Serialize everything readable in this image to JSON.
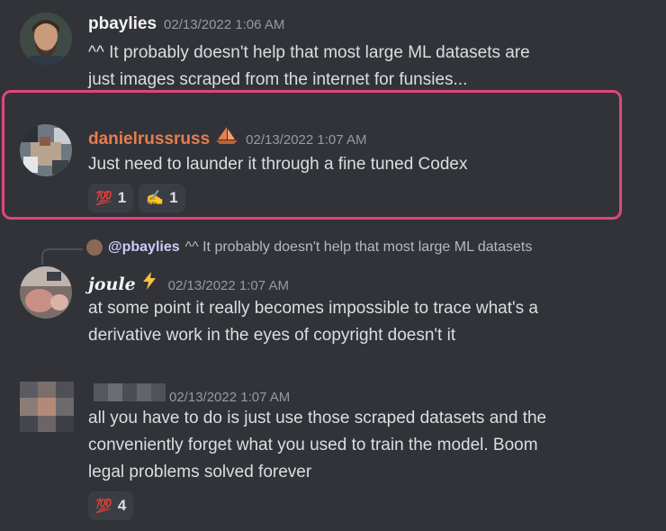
{
  "messages": [
    {
      "username": "pbaylies",
      "timestamp": "02/13/2022 1:06 AM",
      "lines": [
        "^^ It probably doesn't help that most large ML datasets are",
        "just images scraped from the internet for funsies..."
      ]
    },
    {
      "username": "danielrussruss",
      "badge_icon": "sailboat-icon",
      "timestamp": "02/13/2022 1:07 AM",
      "lines": [
        "Just need to launder it through a fine tuned Codex"
      ],
      "reactions": [
        {
          "emoji": "💯",
          "count": "1"
        },
        {
          "emoji": "✍",
          "count": "1"
        }
      ]
    },
    {
      "reply_to": {
        "mention": "@pbaylies",
        "text": "^^ It probably doesn't help that most large ML datasets"
      },
      "username": "joule",
      "badge_icon": "lightning-icon",
      "timestamp": "02/13/2022 1:07 AM",
      "lines": [
        "at some point it really becomes impossible to trace what's a",
        "derivative work in the eyes of copyright doesn't it"
      ]
    },
    {
      "username": "",
      "timestamp": "02/13/2022 1:07 AM",
      "lines": [
        "all you have to do is just use those scraped datasets and the",
        "conveniently forget what you used to train the model. Boom",
        "legal problems solved forever"
      ],
      "reactions": [
        {
          "emoji": "💯",
          "count": "4"
        }
      ]
    }
  ],
  "colors": {
    "background": "#313338",
    "highlight": "#e0457b",
    "danielrussruss_name": "#e67e50",
    "timestamp": "#949ba4"
  }
}
